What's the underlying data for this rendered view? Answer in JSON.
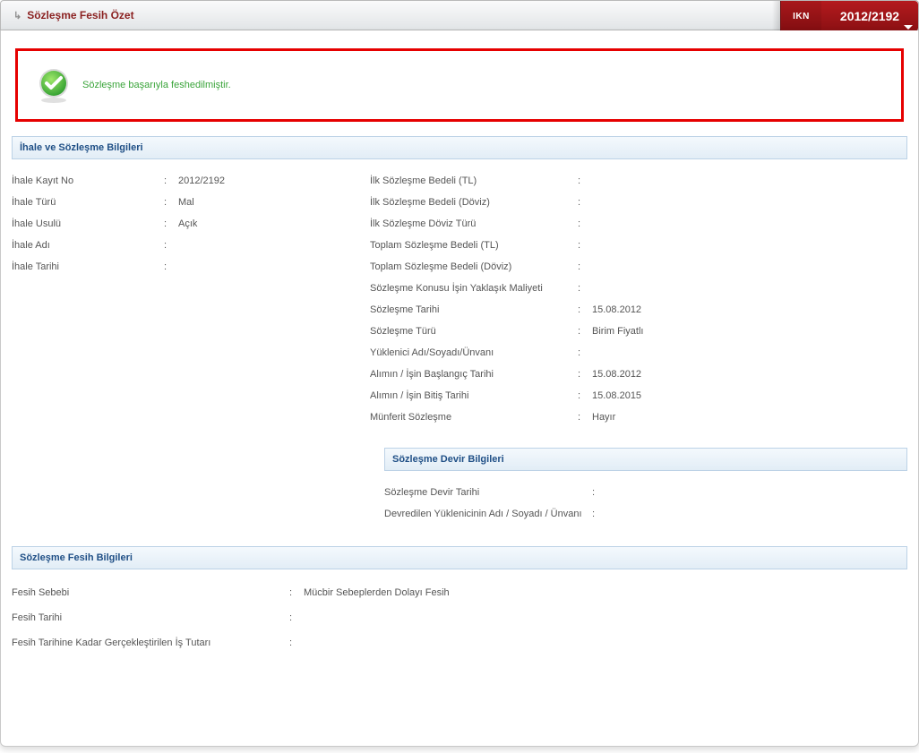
{
  "header": {
    "title": "Sözleşme Fesih Özet",
    "ikn_label": "IKN",
    "ikn_value": "2012/2192"
  },
  "success": {
    "message": "Sözleşme başarıyla feshedilmiştir."
  },
  "sections": {
    "ihale_header": "İhale ve Sözleşme Bilgileri",
    "devir_header": "Sözleşme Devir Bilgileri",
    "fesih_header": "Sözleşme Fesih Bilgileri"
  },
  "ihale_left": {
    "kayit_no_label": "İhale Kayıt No",
    "kayit_no_value": "2012/2192",
    "turu_label": "İhale Türü",
    "turu_value": "Mal",
    "usulu_label": "İhale Usulü",
    "usulu_value": "Açık",
    "adi_label": "İhale Adı",
    "adi_value": "",
    "tarihi_label": "İhale Tarihi",
    "tarihi_value": ""
  },
  "ihale_right": {
    "ilk_tl_label": "İlk Sözleşme Bedeli (TL)",
    "ilk_tl_value": "",
    "ilk_doviz_label": "İlk Sözleşme Bedeli (Döviz)",
    "ilk_doviz_value": "",
    "ilk_doviz_turu_label": "İlk Sözleşme Döviz Türü",
    "ilk_doviz_turu_value": "",
    "toplam_tl_label": "Toplam Sözleşme Bedeli (TL)",
    "toplam_tl_value": "",
    "toplam_doviz_label": "Toplam Sözleşme Bedeli (Döviz)",
    "toplam_doviz_value": "",
    "yaklasik_label": "Sözleşme Konusu İşin Yaklaşık Maliyeti",
    "yaklasik_value": "",
    "soz_tarih_label": "Sözleşme Tarihi",
    "soz_tarih_value": "15.08.2012",
    "soz_turu_label": "Sözleşme Türü",
    "soz_turu_value": "Birim Fiyatlı",
    "yuklenici_label": "Yüklenici Adı/Soyadı/Ünvanı",
    "yuklenici_value": "",
    "baslangic_label": "Alımın / İşin Başlangıç Tarihi",
    "baslangic_value": "15.08.2012",
    "bitis_label": "Alımın / İşin Bitiş Tarihi",
    "bitis_value": "15.08.2015",
    "munferit_label": "Münferit Sözleşme",
    "munferit_value": "Hayır"
  },
  "devir": {
    "tarih_label": "Sözleşme Devir Tarihi",
    "tarih_value": "",
    "devredilen_label": "Devredilen Yüklenicinin Adı / Soyadı / Ünvanı",
    "devredilen_value": ""
  },
  "fesih": {
    "sebep_label": "Fesih Sebebi",
    "sebep_value": "Mücbir Sebeplerden Dolayı Fesih",
    "tarih_label": "Fesih Tarihi",
    "tarih_value": "",
    "tutar_label": "Fesih Tarihine Kadar Gerçekleştirilen İş Tutarı",
    "tutar_value": ""
  }
}
